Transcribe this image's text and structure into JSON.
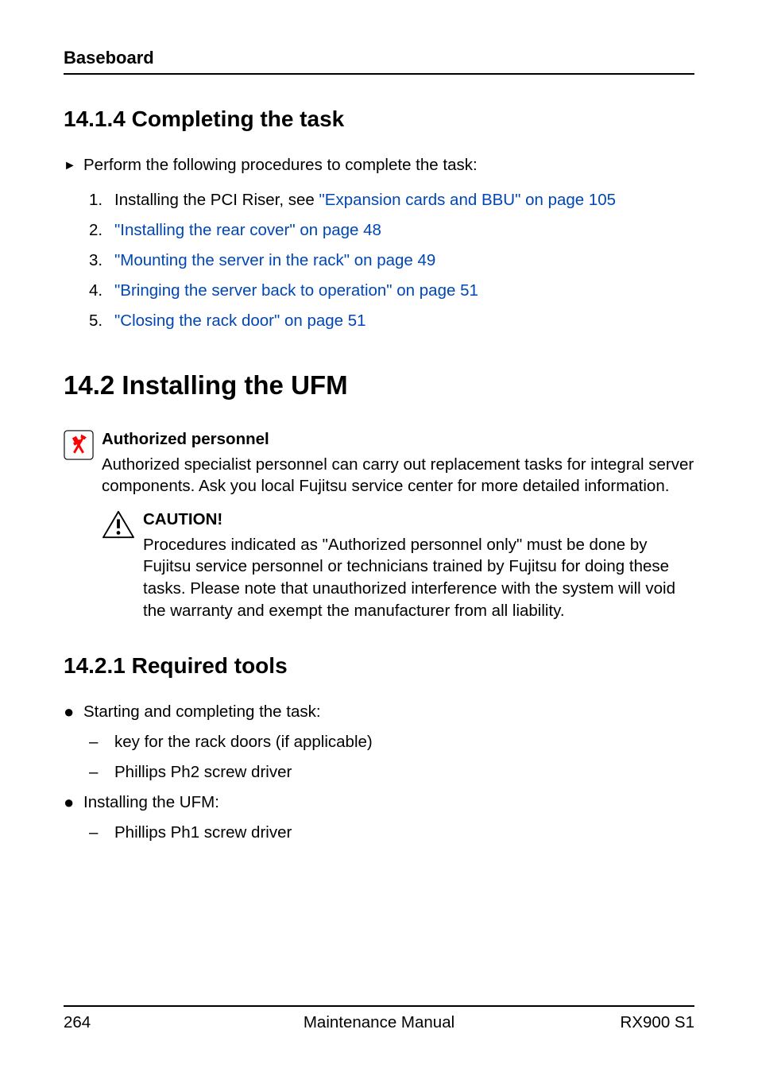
{
  "header": {
    "title": "Baseboard"
  },
  "section_14_1_4": {
    "heading": "14.1.4   Completing the task",
    "intro": "Perform the following procedures to complete the task:",
    "items": [
      {
        "num": "1.",
        "text_prefix": "Installing the PCI Riser, see ",
        "link": "\"Expansion cards and BBU\" on page 105"
      },
      {
        "num": "2.",
        "text_prefix": "",
        "link": "\"Installing the rear cover\" on page 48"
      },
      {
        "num": "3.",
        "text_prefix": "",
        "link": "\"Mounting the server in the rack\" on page 49"
      },
      {
        "num": "4.",
        "text_prefix": "",
        "link": "\"Bringing the server back to operation\" on page 51"
      },
      {
        "num": "5.",
        "text_prefix": "",
        "link": "\"Closing the rack door\" on page 51"
      }
    ]
  },
  "section_14_2": {
    "heading": "14.2    Installing the UFM",
    "note": {
      "title": "Authorized personnel",
      "body": "Authorized specialist personnel can carry out replacement tasks for integral server components. Ask you local Fujitsu service center for more detailed information."
    },
    "caution": {
      "title": "CAUTION!",
      "body": "Procedures indicated as \"Authorized personnel only\" must be done by Fujitsu service personnel or technicians trained by Fujitsu for doing these tasks. Please note that unauthorized interference with the system will void the warranty and exempt the manufacturer from all liability."
    }
  },
  "section_14_2_1": {
    "heading": "14.2.1   Required tools",
    "bullets": [
      {
        "text": "Starting and completing the task:",
        "subitems": [
          "key for the rack doors (if applicable)",
          "Phillips Ph2 screw driver"
        ]
      },
      {
        "text": " Installing the UFM:",
        "subitems": [
          "Phillips Ph1 screw driver"
        ]
      }
    ]
  },
  "footer": {
    "page": "264",
    "center": "Maintenance Manual",
    "right": "RX900 S1"
  }
}
